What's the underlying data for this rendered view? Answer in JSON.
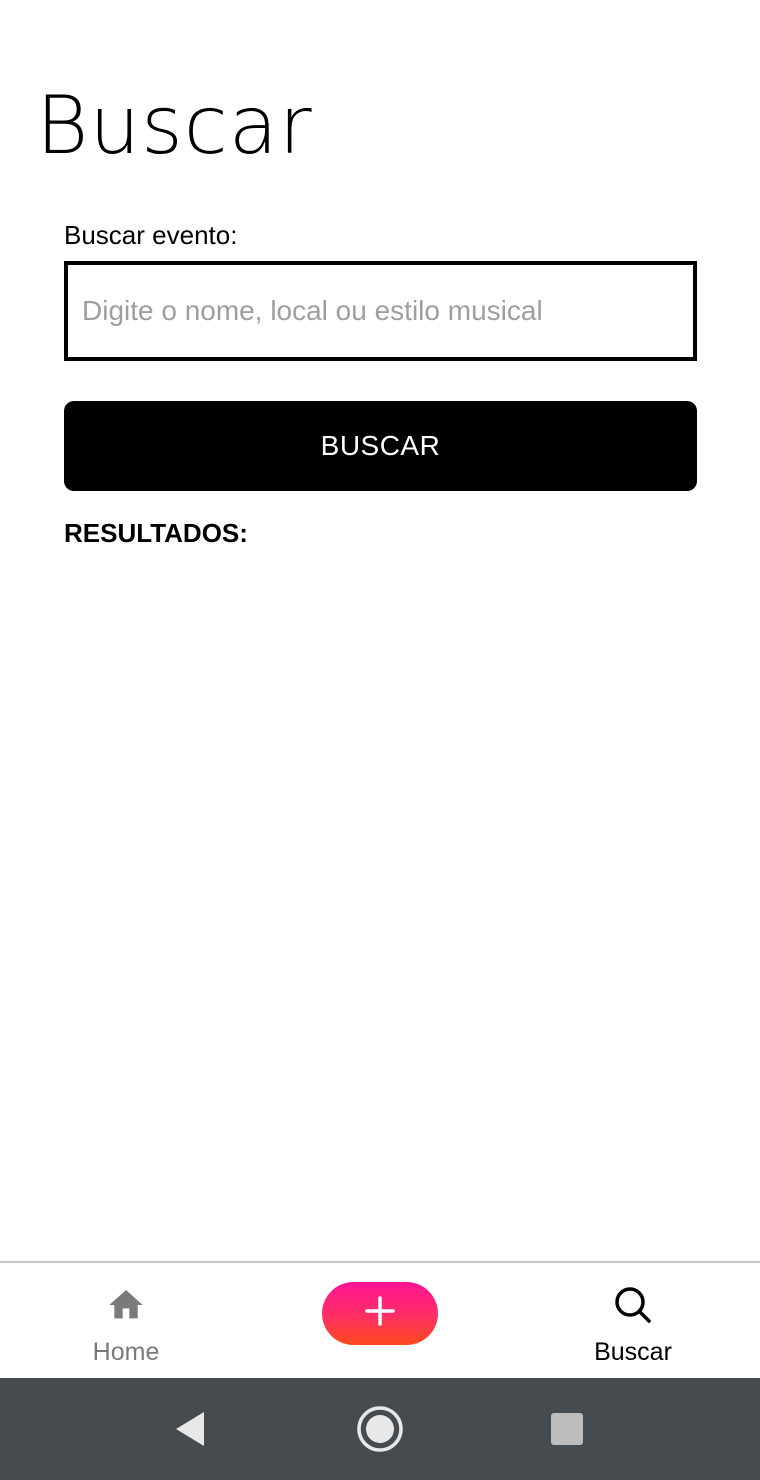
{
  "header": {
    "title": "Buscar"
  },
  "search": {
    "label": "Buscar evento:",
    "value": "",
    "placeholder": "Digite o nome, local ou estilo musical",
    "button_label": "BUSCAR"
  },
  "results": {
    "heading": "RESULTADOS:",
    "items": []
  },
  "bottom_nav": {
    "items": [
      {
        "label": "Home",
        "icon": "home-icon",
        "active": false,
        "color": "#7a7a7a"
      },
      {
        "label": "Buscar",
        "icon": "search-icon",
        "active": true,
        "color": "#000000"
      }
    ],
    "add_button": {
      "icon": "plus-icon",
      "gradient": [
        "#ff1493",
        "#ff4a1c"
      ]
    }
  },
  "system_nav": {
    "buttons": [
      "back-icon",
      "home-circle-icon",
      "recents-square-icon"
    ],
    "color": "#464b50"
  }
}
